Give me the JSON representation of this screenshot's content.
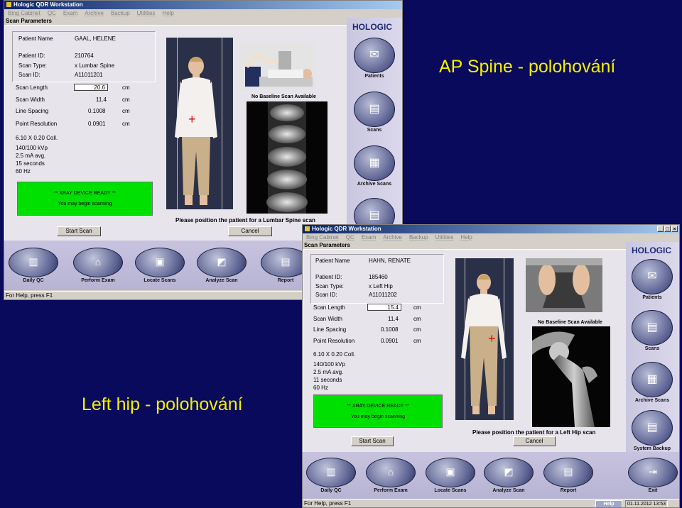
{
  "slide": {
    "title1": "AP Spine - polohování",
    "title2": "Left hip - polohování"
  },
  "spine_window": {
    "title": "Hologic QDR Workstation",
    "menu": [
      "Bing Cabinet",
      "QC",
      "Exam",
      "Archive",
      "Backup",
      "Utilities",
      "Help"
    ],
    "panel_title": "Scan Parameters",
    "patient": {
      "name_label": "Patient Name",
      "name": "GAAL, HELENE",
      "id_label": "Patient ID:",
      "id": "210764",
      "scan_type_label": "Scan Type:",
      "scan_type": "x Lumbar Spine",
      "scan_id_label": "Scan ID:",
      "scan_id": "A11011201"
    },
    "params": [
      {
        "label": "Scan Length",
        "value": "20.6",
        "unit": "cm"
      },
      {
        "label": "Scan Width",
        "value": "11.4",
        "unit": "cm"
      },
      {
        "label": "Line Spacing",
        "value": "0.1008",
        "unit": "cm"
      },
      {
        "label": "Point Resolution",
        "value": "0.0901",
        "unit": "cm"
      }
    ],
    "tech": [
      "6.10 X 0.20 Coll.",
      "140/100 kVp",
      "2.5 mA avg.",
      "15 seconds",
      "60 Hz"
    ],
    "ready_line1": "** XRAY DEVICE READY **",
    "ready_line2": "You may begin scanning",
    "no_baseline": "No Baseline Scan Available",
    "instruction": "Please position the patient for a Lumbar Spine scan",
    "start_label": "Start Scan",
    "cancel_label": "Cancel",
    "logo": "HOLOGIC",
    "side_buttons": [
      "Patients",
      "Scans",
      "Archive Scans"
    ],
    "bottom_buttons": [
      "Daily QC",
      "Perform Exam",
      "Locate Scans",
      "Analyze Scan",
      "Report"
    ],
    "status": "For Help, press F1"
  },
  "hip_window": {
    "title": "Hologic QDR Workstation",
    "menu": [
      "Bing Cabinet",
      "QC",
      "Exam",
      "Archive",
      "Backup",
      "Utilities",
      "Help"
    ],
    "panel_title": "Scan Parameters",
    "patient": {
      "name_label": "Patient Name",
      "name": "HAHN, RENATE",
      "id_label": "Patient ID:",
      "id": "185460",
      "scan_type_label": "Scan Type:",
      "scan_type": "x Left Hip",
      "scan_id_label": "Scan ID:",
      "scan_id": "A11011202"
    },
    "params": [
      {
        "label": "Scan Length",
        "value": "15.4",
        "unit": "cm"
      },
      {
        "label": "Scan Width",
        "value": "11.4",
        "unit": "cm"
      },
      {
        "label": "Line Spacing",
        "value": "0.1008",
        "unit": "cm"
      },
      {
        "label": "Point Resolution",
        "value": "0.0901",
        "unit": "cm"
      }
    ],
    "tech": [
      "6.10 X 0.20 Coll.",
      "140/100 kVp",
      "2.5 mA avg.",
      "11 seconds",
      "60 Hz"
    ],
    "ready_line1": "** XRAY DEVICE READY **",
    "ready_line2": "You may begin scanning",
    "no_baseline": "No Baseline Scan Available",
    "instruction": "Please position the patient for a Left Hip scan",
    "start_label": "Start Scan",
    "cancel_label": "Cancel",
    "logo": "HOLOGIC",
    "side_buttons": [
      "Patients",
      "Scans",
      "Archive Scans",
      "System Backup"
    ],
    "bottom_buttons": [
      "Daily QC",
      "Perform Exam",
      "Locate Scans",
      "Analyze Scan",
      "Report",
      "Exit"
    ],
    "status": "For Help, press F1",
    "help": "Help",
    "clock": "01.11.2012 13:53"
  }
}
